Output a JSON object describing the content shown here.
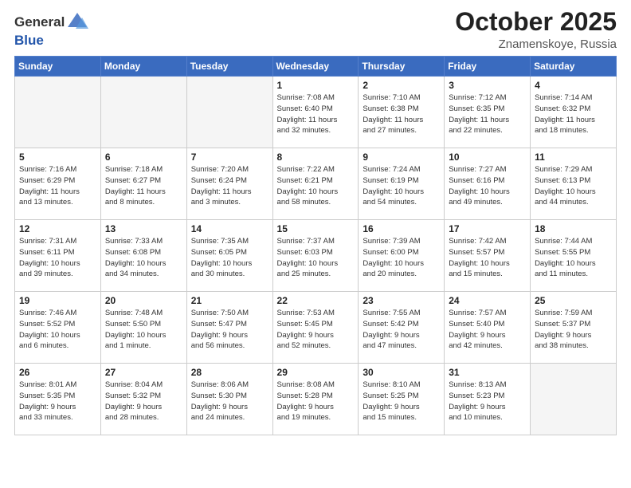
{
  "header": {
    "logo_general": "General",
    "logo_blue": "Blue",
    "title": "October 2025",
    "location": "Znamenskoye, Russia"
  },
  "weekdays": [
    "Sunday",
    "Monday",
    "Tuesday",
    "Wednesday",
    "Thursday",
    "Friday",
    "Saturday"
  ],
  "weeks": [
    [
      {
        "day": "",
        "info": ""
      },
      {
        "day": "",
        "info": ""
      },
      {
        "day": "",
        "info": ""
      },
      {
        "day": "1",
        "info": "Sunrise: 7:08 AM\nSunset: 6:40 PM\nDaylight: 11 hours\nand 32 minutes."
      },
      {
        "day": "2",
        "info": "Sunrise: 7:10 AM\nSunset: 6:38 PM\nDaylight: 11 hours\nand 27 minutes."
      },
      {
        "day": "3",
        "info": "Sunrise: 7:12 AM\nSunset: 6:35 PM\nDaylight: 11 hours\nand 22 minutes."
      },
      {
        "day": "4",
        "info": "Sunrise: 7:14 AM\nSunset: 6:32 PM\nDaylight: 11 hours\nand 18 minutes."
      }
    ],
    [
      {
        "day": "5",
        "info": "Sunrise: 7:16 AM\nSunset: 6:29 PM\nDaylight: 11 hours\nand 13 minutes."
      },
      {
        "day": "6",
        "info": "Sunrise: 7:18 AM\nSunset: 6:27 PM\nDaylight: 11 hours\nand 8 minutes."
      },
      {
        "day": "7",
        "info": "Sunrise: 7:20 AM\nSunset: 6:24 PM\nDaylight: 11 hours\nand 3 minutes."
      },
      {
        "day": "8",
        "info": "Sunrise: 7:22 AM\nSunset: 6:21 PM\nDaylight: 10 hours\nand 58 minutes."
      },
      {
        "day": "9",
        "info": "Sunrise: 7:24 AM\nSunset: 6:19 PM\nDaylight: 10 hours\nand 54 minutes."
      },
      {
        "day": "10",
        "info": "Sunrise: 7:27 AM\nSunset: 6:16 PM\nDaylight: 10 hours\nand 49 minutes."
      },
      {
        "day": "11",
        "info": "Sunrise: 7:29 AM\nSunset: 6:13 PM\nDaylight: 10 hours\nand 44 minutes."
      }
    ],
    [
      {
        "day": "12",
        "info": "Sunrise: 7:31 AM\nSunset: 6:11 PM\nDaylight: 10 hours\nand 39 minutes."
      },
      {
        "day": "13",
        "info": "Sunrise: 7:33 AM\nSunset: 6:08 PM\nDaylight: 10 hours\nand 34 minutes."
      },
      {
        "day": "14",
        "info": "Sunrise: 7:35 AM\nSunset: 6:05 PM\nDaylight: 10 hours\nand 30 minutes."
      },
      {
        "day": "15",
        "info": "Sunrise: 7:37 AM\nSunset: 6:03 PM\nDaylight: 10 hours\nand 25 minutes."
      },
      {
        "day": "16",
        "info": "Sunrise: 7:39 AM\nSunset: 6:00 PM\nDaylight: 10 hours\nand 20 minutes."
      },
      {
        "day": "17",
        "info": "Sunrise: 7:42 AM\nSunset: 5:57 PM\nDaylight: 10 hours\nand 15 minutes."
      },
      {
        "day": "18",
        "info": "Sunrise: 7:44 AM\nSunset: 5:55 PM\nDaylight: 10 hours\nand 11 minutes."
      }
    ],
    [
      {
        "day": "19",
        "info": "Sunrise: 7:46 AM\nSunset: 5:52 PM\nDaylight: 10 hours\nand 6 minutes."
      },
      {
        "day": "20",
        "info": "Sunrise: 7:48 AM\nSunset: 5:50 PM\nDaylight: 10 hours\nand 1 minute."
      },
      {
        "day": "21",
        "info": "Sunrise: 7:50 AM\nSunset: 5:47 PM\nDaylight: 9 hours\nand 56 minutes."
      },
      {
        "day": "22",
        "info": "Sunrise: 7:53 AM\nSunset: 5:45 PM\nDaylight: 9 hours\nand 52 minutes."
      },
      {
        "day": "23",
        "info": "Sunrise: 7:55 AM\nSunset: 5:42 PM\nDaylight: 9 hours\nand 47 minutes."
      },
      {
        "day": "24",
        "info": "Sunrise: 7:57 AM\nSunset: 5:40 PM\nDaylight: 9 hours\nand 42 minutes."
      },
      {
        "day": "25",
        "info": "Sunrise: 7:59 AM\nSunset: 5:37 PM\nDaylight: 9 hours\nand 38 minutes."
      }
    ],
    [
      {
        "day": "26",
        "info": "Sunrise: 8:01 AM\nSunset: 5:35 PM\nDaylight: 9 hours\nand 33 minutes."
      },
      {
        "day": "27",
        "info": "Sunrise: 8:04 AM\nSunset: 5:32 PM\nDaylight: 9 hours\nand 28 minutes."
      },
      {
        "day": "28",
        "info": "Sunrise: 8:06 AM\nSunset: 5:30 PM\nDaylight: 9 hours\nand 24 minutes."
      },
      {
        "day": "29",
        "info": "Sunrise: 8:08 AM\nSunset: 5:28 PM\nDaylight: 9 hours\nand 19 minutes."
      },
      {
        "day": "30",
        "info": "Sunrise: 8:10 AM\nSunset: 5:25 PM\nDaylight: 9 hours\nand 15 minutes."
      },
      {
        "day": "31",
        "info": "Sunrise: 8:13 AM\nSunset: 5:23 PM\nDaylight: 9 hours\nand 10 minutes."
      },
      {
        "day": "",
        "info": ""
      }
    ]
  ]
}
